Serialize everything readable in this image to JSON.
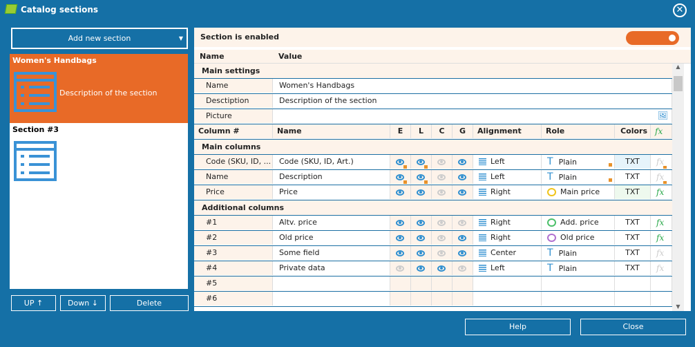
{
  "window": {
    "title": "Catalog sections"
  },
  "left": {
    "add_label": "Add new section",
    "sections": [
      {
        "title": "Women's Handbags",
        "description": "Description of the section",
        "selected": true
      },
      {
        "title": "Section #3",
        "description": "",
        "selected": false
      }
    ],
    "up_label": "UP ↑",
    "down_label": "Down ↓",
    "delete_label": "Delete"
  },
  "panel": {
    "enabled_label": "Section is enabled",
    "enabled": true,
    "header": {
      "name": "Name",
      "value": "Value"
    },
    "main_settings": {
      "label": "Main settings",
      "rows": [
        {
          "name": "Name",
          "value": "Women's Handbags"
        },
        {
          "name": "Desctiption",
          "value": "Description of the section"
        },
        {
          "name": "Picture",
          "value": ""
        }
      ]
    },
    "columns_header": {
      "col": "Column #",
      "name": "Name",
      "e": "E",
      "l": "L",
      "c": "C",
      "g": "G",
      "alignment": "Alignment",
      "role": "Role",
      "colors": "Colors",
      "fx": "fx"
    },
    "groups": [
      {
        "label": "Main columns",
        "rows": [
          {
            "col": "Code (SKU, ID, ...",
            "name": "Code (SKU, ID, Art.)",
            "eye": [
              "on-lock",
              "on-lock",
              "off",
              "on"
            ],
            "align": "Left",
            "role": "Plain",
            "role_icon": "T",
            "role_lock": true,
            "colors": "TXT",
            "colors_bg": "#e6f4fb",
            "fx": "off-lock"
          },
          {
            "col": "Name",
            "name": "Description",
            "eye": [
              "on-lock",
              "on-lock",
              "off",
              "on"
            ],
            "align": "Left",
            "role": "Plain",
            "role_icon": "T",
            "role_lock": true,
            "colors": "TXT",
            "colors_bg": "",
            "fx": "off-lock"
          },
          {
            "col": "Price",
            "name": "Price",
            "eye": [
              "on",
              "on",
              "off",
              "on"
            ],
            "align": "Right",
            "role": "Main price",
            "role_icon": "coin",
            "role_color": "#f0c419",
            "colors": "TXT",
            "colors_bg": "#eef9ee",
            "fx": "on"
          }
        ]
      },
      {
        "label": "Additional columns",
        "rows": [
          {
            "col": "#1",
            "name": "Altv. price",
            "eye": [
              "on",
              "on",
              "off",
              "off"
            ],
            "align": "Right",
            "role": "Add. price",
            "role_icon": "coin",
            "role_color": "#4cc06a",
            "colors": "TXT",
            "fx": "on"
          },
          {
            "col": "#2",
            "name": "Old price",
            "eye": [
              "on",
              "on",
              "off",
              "on"
            ],
            "align": "Right",
            "role": "Old price",
            "role_icon": "coin",
            "role_color": "#b070d0",
            "colors": "TXT",
            "fx": "on"
          },
          {
            "col": "#3",
            "name": "Some field",
            "eye": [
              "on",
              "on",
              "off",
              "on"
            ],
            "align": "Center",
            "role": "Plain",
            "role_icon": "T",
            "colors": "TXT",
            "fx": "off"
          },
          {
            "col": "#4",
            "name": "Private data",
            "eye": [
              "off",
              "on",
              "on",
              "off"
            ],
            "align": "Left",
            "role": "Plain",
            "role_icon": "T",
            "colors": "TXT",
            "fx": "off"
          },
          {
            "col": "#5",
            "name": "",
            "eye": [],
            "align": "",
            "role": "",
            "colors": "",
            "fx": ""
          },
          {
            "col": "#6",
            "name": "",
            "eye": [],
            "align": "",
            "role": "",
            "colors": "",
            "fx": ""
          }
        ]
      }
    ]
  },
  "footer": {
    "help_label": "Help",
    "close_label": "Close"
  }
}
